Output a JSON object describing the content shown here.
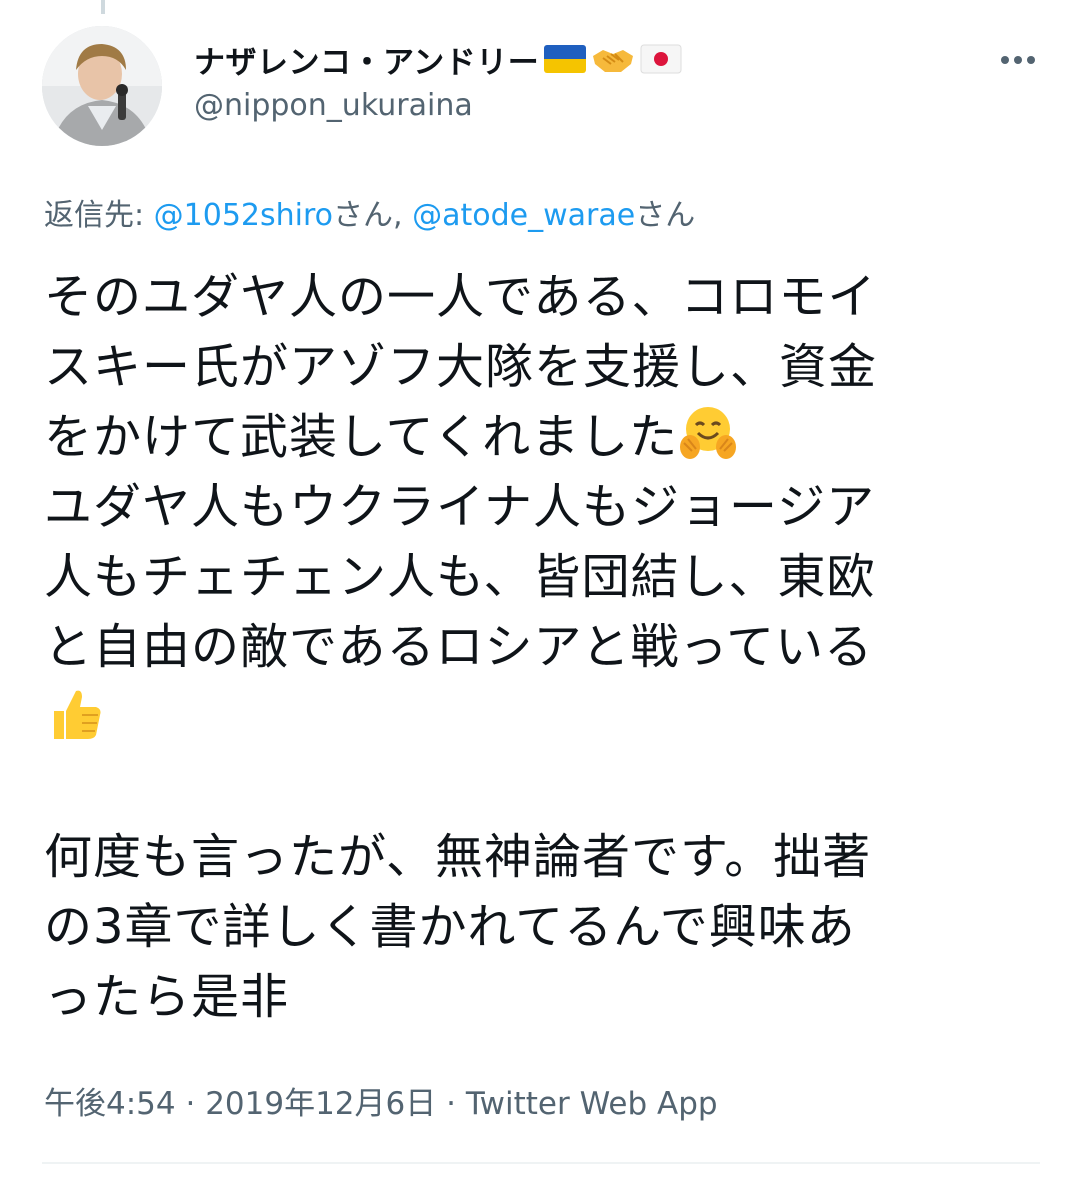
{
  "author": {
    "display_name": "ナザレンコ・アンドリー",
    "name_emojis": [
      "ukraine-flag",
      "handshake",
      "japan-flag"
    ],
    "handle": "@nippon_ukuraina"
  },
  "reply_to": {
    "prefix": "返信先: ",
    "mention1": "@1052shiro",
    "suffix1": "さん, ",
    "mention2": "@atode_warae",
    "suffix2": "さん"
  },
  "tweet": {
    "line1": "そのユダヤ人の一人である、コロモイ",
    "line2": "スキー氏がアゾフ大隊を支援し、資金",
    "line3": "をかけて武装してくれました",
    "line4": "ユダヤ人もウクライナ人もジョージア",
    "line5": "人もチェチェン人も、皆団結し、東欧",
    "line6": "と自由の敵であるロシアと戦っている",
    "line7": "何度も言ったが、無神論者です。拙著",
    "line8": "の3章で詳しく書かれてるんで興味あ",
    "line9": "ったら是非",
    "emojis": [
      "hugging-face",
      "thumbs-up"
    ]
  },
  "meta": {
    "time": "午後4:54",
    "sep1": " · ",
    "date": "2019年12月6日",
    "sep2": " · ",
    "source": "Twitter Web App"
  },
  "colors": {
    "link": "#1d9bf0",
    "secondary_text": "#536471",
    "primary_text": "#0f1419",
    "divider": "#eff3f4"
  }
}
